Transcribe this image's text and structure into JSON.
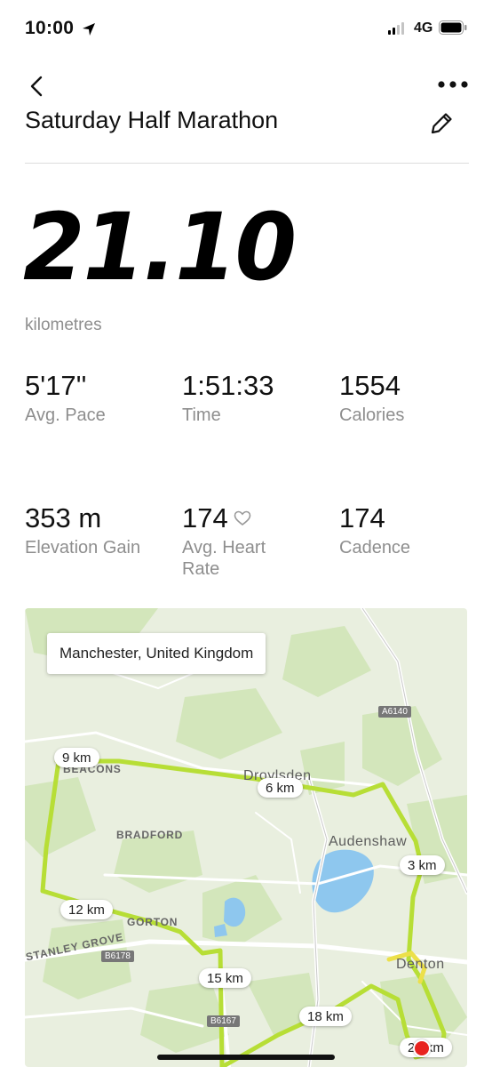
{
  "status_bar": {
    "time": "10:00",
    "network": "4G",
    "icons": [
      "location-arrow-icon",
      "signal-icon",
      "battery-icon"
    ]
  },
  "header": {
    "title": "Saturday Half Marathon",
    "icons": [
      "back-chevron-icon",
      "more-dots-icon",
      "pencil-icon"
    ]
  },
  "summary": {
    "distance": "21.10",
    "unit": "kilometres"
  },
  "stats": [
    {
      "value": "5'17''",
      "label": "Avg. Pace"
    },
    {
      "value": "1:51:33",
      "label": "Time"
    },
    {
      "value": "1554",
      "label": "Calories"
    },
    {
      "value": "353 m",
      "label": "Elevation Gain"
    },
    {
      "value": "174",
      "label": "Avg. Heart Rate",
      "icon": "heart-outline-icon"
    },
    {
      "value": "174",
      "label": "Cadence"
    }
  ],
  "map": {
    "location": "Manchester, United Kingdom",
    "km_markers": [
      "9 km",
      "6 km",
      "3 km",
      "12 km",
      "15 km",
      "18 km",
      "21 km"
    ],
    "place_labels": [
      "BEACONS",
      "Droylsden",
      "BRADFORD",
      "Audenshaw",
      "GORTON",
      "STANLEY GROVE",
      "Denton"
    ],
    "road_labels": [
      "A6140",
      "B6178",
      "B6167"
    ],
    "colors": {
      "route": "#b7de36",
      "water": "#8ec7ee",
      "park": "#cfe3b4",
      "end_marker": "#e8231f"
    }
  }
}
